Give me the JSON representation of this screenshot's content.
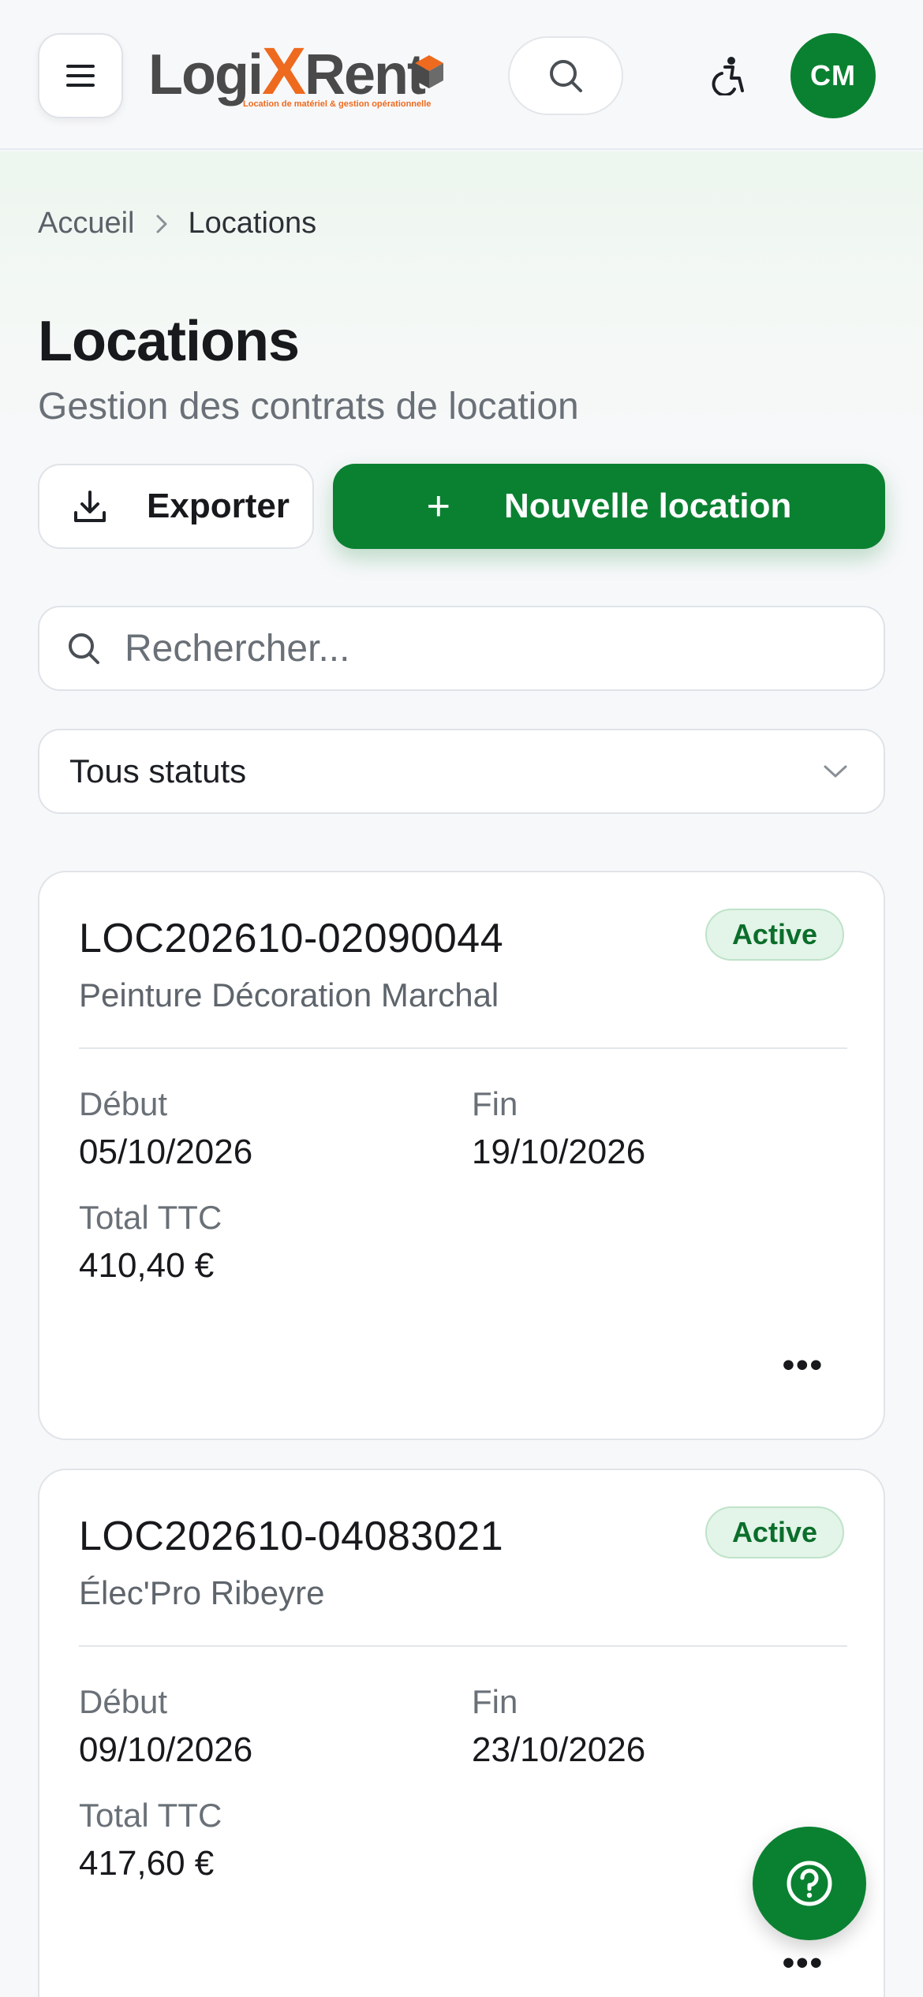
{
  "header": {
    "logo_main_left": "Logi",
    "logo_x": "X",
    "logo_main_right": "Rent",
    "logo_tagline": "Location de matériel & gestion opérationnelle",
    "avatar_initials": "CM",
    "brand_color": "#0a8131",
    "accent_color": "#ee6a1e"
  },
  "breadcrumb": {
    "home": "Accueil",
    "current": "Locations"
  },
  "page": {
    "title": "Locations",
    "subtitle": "Gestion des contrats de location"
  },
  "actions": {
    "export_label": "Exporter",
    "new_label": "Nouvelle location",
    "new_plus": "+"
  },
  "search": {
    "placeholder": "Rechercher..."
  },
  "filter": {
    "selected": "Tous statuts"
  },
  "rentals": [
    {
      "ref": "LOC202610-02090044",
      "client": "Peinture Décoration Marchal",
      "status": "Active",
      "start_label": "Début",
      "start": "05/10/2026",
      "end_label": "Fin",
      "end": "19/10/2026",
      "total_label": "Total TTC",
      "total": "410,40 €",
      "more": "•••"
    },
    {
      "ref": "LOC202610-04083021",
      "client": "Élec'Pro Ribeyre",
      "status": "Active",
      "start_label": "Début",
      "start": "09/10/2026",
      "end_label": "Fin",
      "end": "23/10/2026",
      "total_label": "Total TTC",
      "total": "417,60 €",
      "more": "•••"
    }
  ],
  "icons": {
    "menu": "menu-icon",
    "search": "search-icon",
    "accessibility": "accessibility-icon",
    "download": "download-icon",
    "chevron": "chevron-down-icon",
    "help": "help-icon"
  }
}
